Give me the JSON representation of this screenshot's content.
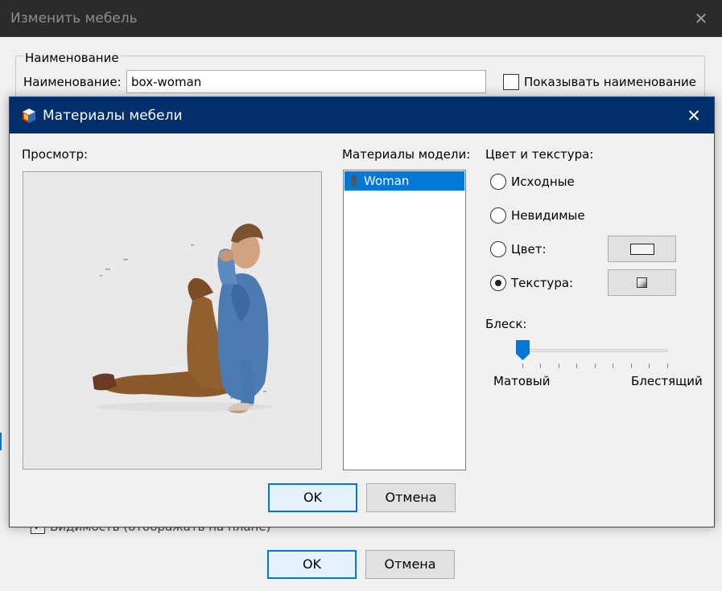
{
  "background_dialog": {
    "title": "Изменить мебель",
    "close_icon": "close-icon",
    "group_legend": "Наименование",
    "name_label": "Наименование:",
    "name_value": "box-woman",
    "show_name_label": "Показывать наименование",
    "visibility_label": "Видимость (отображать на плане)",
    "ok_label": "OK",
    "cancel_label": "Отмена"
  },
  "materials_dialog": {
    "title": "Материалы мебели",
    "app_icon": "app-cube-icon",
    "close_icon": "close-icon",
    "preview_label": "Просмотр:",
    "preview_image": "seated-man-3d-model",
    "materials_label": "Материалы модели:",
    "materials": [
      {
        "name": "Woman",
        "icon": "material-icon",
        "selected": true
      }
    ],
    "color_texture_label": "Цвет и текстура:",
    "options": [
      {
        "label": "Исходные",
        "checked": false
      },
      {
        "label": "Невидимые",
        "checked": false
      },
      {
        "label": "Цвет:",
        "checked": false
      },
      {
        "label": "Текстура:",
        "checked": true
      }
    ],
    "color_swatch": "#f2f2f2",
    "texture_icon": "texture-gradient-icon",
    "shininess_label": "Блеск:",
    "shininess_value": 0,
    "shininess_min_label": "Матовый",
    "shininess_max_label": "Блестящий",
    "ok_label": "OK",
    "cancel_label": "Отмена"
  },
  "colors": {
    "accent": "#0078d7",
    "titlebar_active": "#002f6c",
    "titlebar_inactive": "#2b2b2b"
  }
}
